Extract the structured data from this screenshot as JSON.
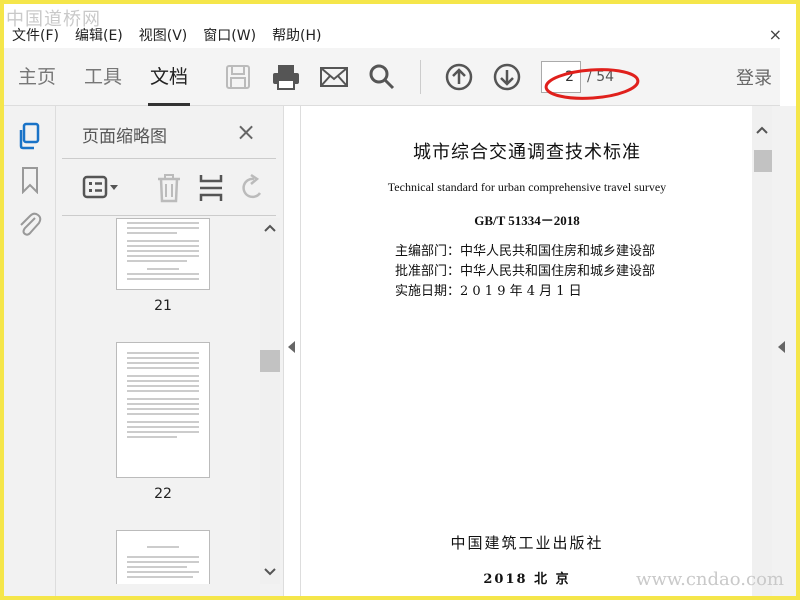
{
  "watermarks": {
    "top": "中国道桥网",
    "bottom": "www.cndao.com"
  },
  "menubar": {
    "items": [
      "文件(F)",
      "编辑(E)",
      "视图(V)",
      "窗口(W)",
      "帮助(H)"
    ],
    "close": "×"
  },
  "toolbar": {
    "tabs": [
      "主页",
      "工具",
      "文档"
    ],
    "active_tab": "文档",
    "icons": [
      "save-icon",
      "print-icon",
      "email-icon",
      "search-icon",
      "page-up-icon",
      "page-down-icon"
    ],
    "page_current": "2",
    "page_total": "/ 54",
    "login": "登录"
  },
  "sidebar": {
    "icons": [
      "page-thumbnails-icon",
      "bookmark-icon",
      "attachment-icon"
    ]
  },
  "thumb_panel": {
    "title": "页面缩略图",
    "close": "×",
    "tool_icons": [
      "options-menu-icon",
      "delete-icon",
      "extract-icon",
      "rotate-icon"
    ],
    "pages": [
      {
        "label": "21"
      },
      {
        "label": "22"
      },
      {
        "label": ""
      }
    ]
  },
  "document": {
    "title": "城市综合交通调查技术标准",
    "english_title": "Technical standard for urban comprehensive travel survey",
    "code": "GB/T 51334－2018",
    "info": [
      "主编部门：中华人民共和国住房和城乡建设部",
      "批准部门：中华人民共和国住房和城乡建设部",
      "实施日期：2 0 1 9 年 4 月 1 日"
    ],
    "publisher": "中国建筑工业出版社",
    "year_place": "2018  北  京"
  },
  "colors": {
    "accent": "#1a73c7",
    "annotation": "#e0201c",
    "border": "#f5e64a"
  }
}
